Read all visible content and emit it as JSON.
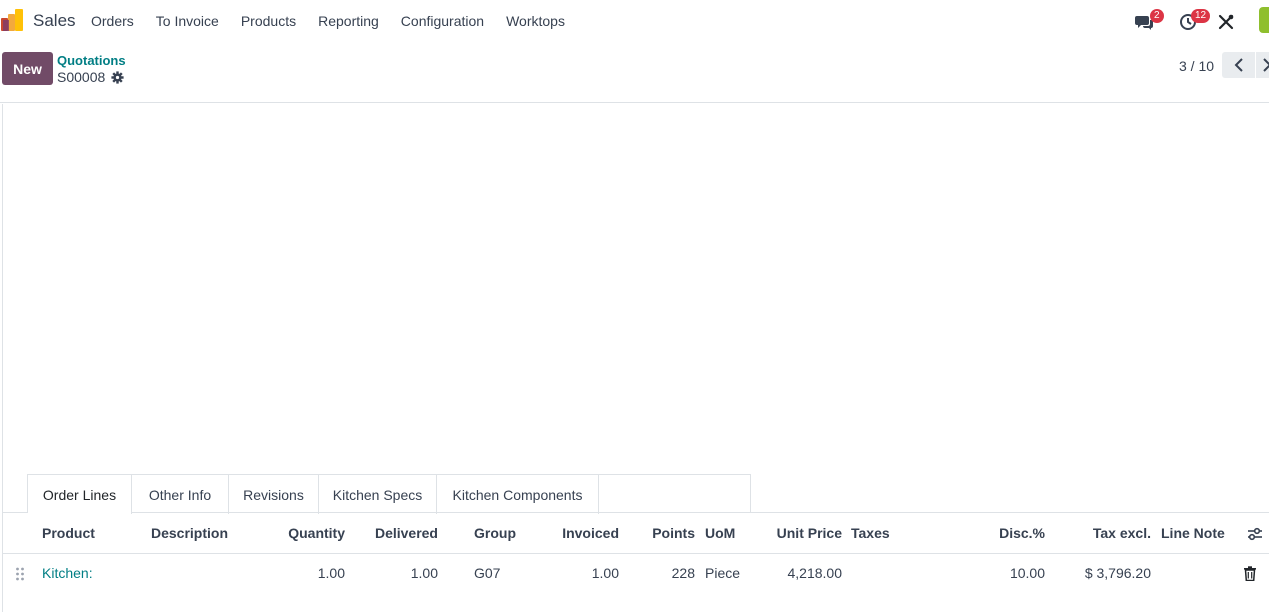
{
  "navbar": {
    "app_name": "Sales",
    "menu": [
      "Orders",
      "To Invoice",
      "Products",
      "Reporting",
      "Configuration",
      "Worktops"
    ],
    "messages_badge": "2",
    "activities_badge": "12",
    "icons": [
      "sales-app-logo",
      "chat-icon",
      "clock-icon",
      "tools-icon"
    ]
  },
  "control_panel": {
    "new_label": "New",
    "breadcrumb": "Quotations",
    "record_name": "S00008",
    "pager": "3 / 10"
  },
  "tabs": [
    {
      "label": "Order Lines",
      "active": true
    },
    {
      "label": "Other Info",
      "active": false
    },
    {
      "label": "Revisions",
      "active": false
    },
    {
      "label": "Kitchen Specs",
      "active": false
    },
    {
      "label": "Kitchen Components",
      "active": false
    }
  ],
  "table": {
    "columns": [
      "Product",
      "Description",
      "Quantity",
      "Delivered",
      "Group",
      "Invoiced",
      "Points",
      "UoM",
      "Unit Price",
      "Taxes",
      "Disc.%",
      "Tax excl.",
      "Line Note"
    ],
    "rows": [
      {
        "product": "Kitchen:",
        "description": "",
        "quantity": "1.00",
        "delivered": "1.00",
        "group": "G07",
        "invoiced": "1.00",
        "points": "228",
        "uom": "Piece",
        "unit_price": "4,218.00",
        "taxes": "",
        "discount": "10.00",
        "tax_excl": "$ 3,796.20",
        "line_note": ""
      }
    ]
  },
  "colors": {
    "primary": "#714b67",
    "link": "#017e84",
    "badge": "#dc3545"
  }
}
